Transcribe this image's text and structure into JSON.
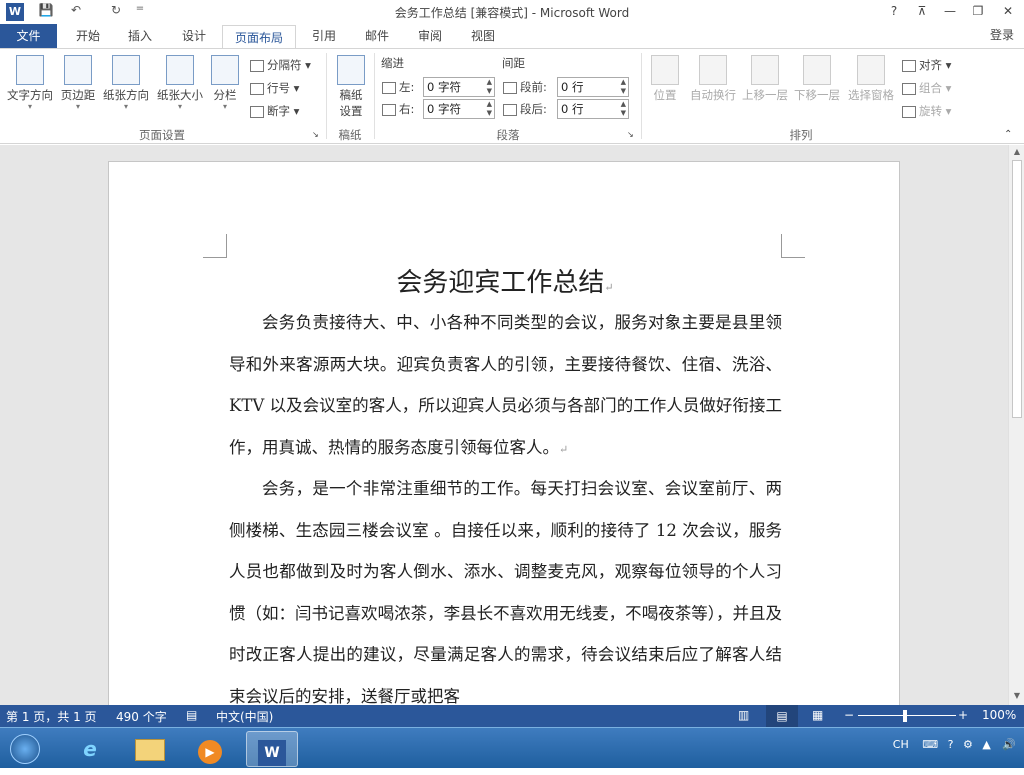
{
  "window": {
    "title": "会务工作总结 [兼容模式] - Microsoft Word",
    "help": "?",
    "ribbon_display": "⊼",
    "minimize": "—",
    "restore": "❐",
    "close": "✕"
  },
  "quick_access": {
    "word_logo": "W",
    "save": "💾",
    "undo": "↶",
    "redo": "↻",
    "customize": "="
  },
  "tabs": {
    "file": "文件",
    "items": [
      "开始",
      "插入",
      "设计",
      "页面布局",
      "引用",
      "邮件",
      "审阅",
      "视图"
    ],
    "active": "页面布局",
    "login": "登录"
  },
  "ribbon": {
    "page_setup": {
      "text_direction": "文字方向",
      "margins": "页边距",
      "orientation": "纸张方向",
      "size": "纸张大小",
      "columns": "分栏",
      "breaks": "分隔符",
      "line_numbers": "行号",
      "hyphenation": "断字",
      "group_label": "页面设置"
    },
    "manuscript": {
      "button_line1": "稿纸",
      "button_line2": "设置",
      "group_label": "稿纸"
    },
    "paragraph": {
      "indent_header": "缩进",
      "spacing_header": "间距",
      "left_label": "左:",
      "right_label": "右:",
      "left_value": "0 字符",
      "right_value": "0 字符",
      "before_label": "段前:",
      "after_label": "段后:",
      "before_value": "0 行",
      "after_value": "0 行",
      "group_label": "段落"
    },
    "arrange": {
      "position": "位置",
      "wrap_text": "自动换行",
      "bring_forward": "上移一层",
      "send_backward": "下移一层",
      "selection_pane": "选择窗格",
      "align": "对齐",
      "group": "组合",
      "rotate": "旋转",
      "group_label": "排列"
    }
  },
  "document": {
    "title": "会务迎宾工作总结",
    "paragraphs": [
      "会务负责接待大、中、小各种不同类型的会议，服务对象主要是县里领导和外来客源两大块。迎宾负责客人的引领，主要接待餐饮、住宿、洗浴、KTV 以及会议室的客人，所以迎宾人员必须与各部门的工作人员做好衔接工作，用真诚、热情的服务态度引领每位客人。",
      "会务，是一个非常注重细节的工作。每天打扫会议室、会议室前厅、两侧楼梯、生态园三楼会议室 。自接任以来，顺利的接待了 12 次会议，服务人员也都做到及时为客人倒水、添水、调整麦克风，观察每位领导的个人习惯（如：闫书记喜欢喝浓茶，李县长不喜欢用无线麦，不喝夜茶等），并且及时改正客人提出的建议，尽量满足客人的需求，待会议结束后应了解客人结束会议后的安排，送餐厅或把客"
    ],
    "paragraph_mark": "↵"
  },
  "status": {
    "page": "第 1 页，共 1 页",
    "words": "490 个字",
    "language": "中文(中国)",
    "zoom": "100%"
  },
  "taskbar": {
    "ime": "CH",
    "apps": [
      "start-orb",
      "internet-explorer",
      "file-explorer",
      "media-player",
      "word"
    ]
  }
}
